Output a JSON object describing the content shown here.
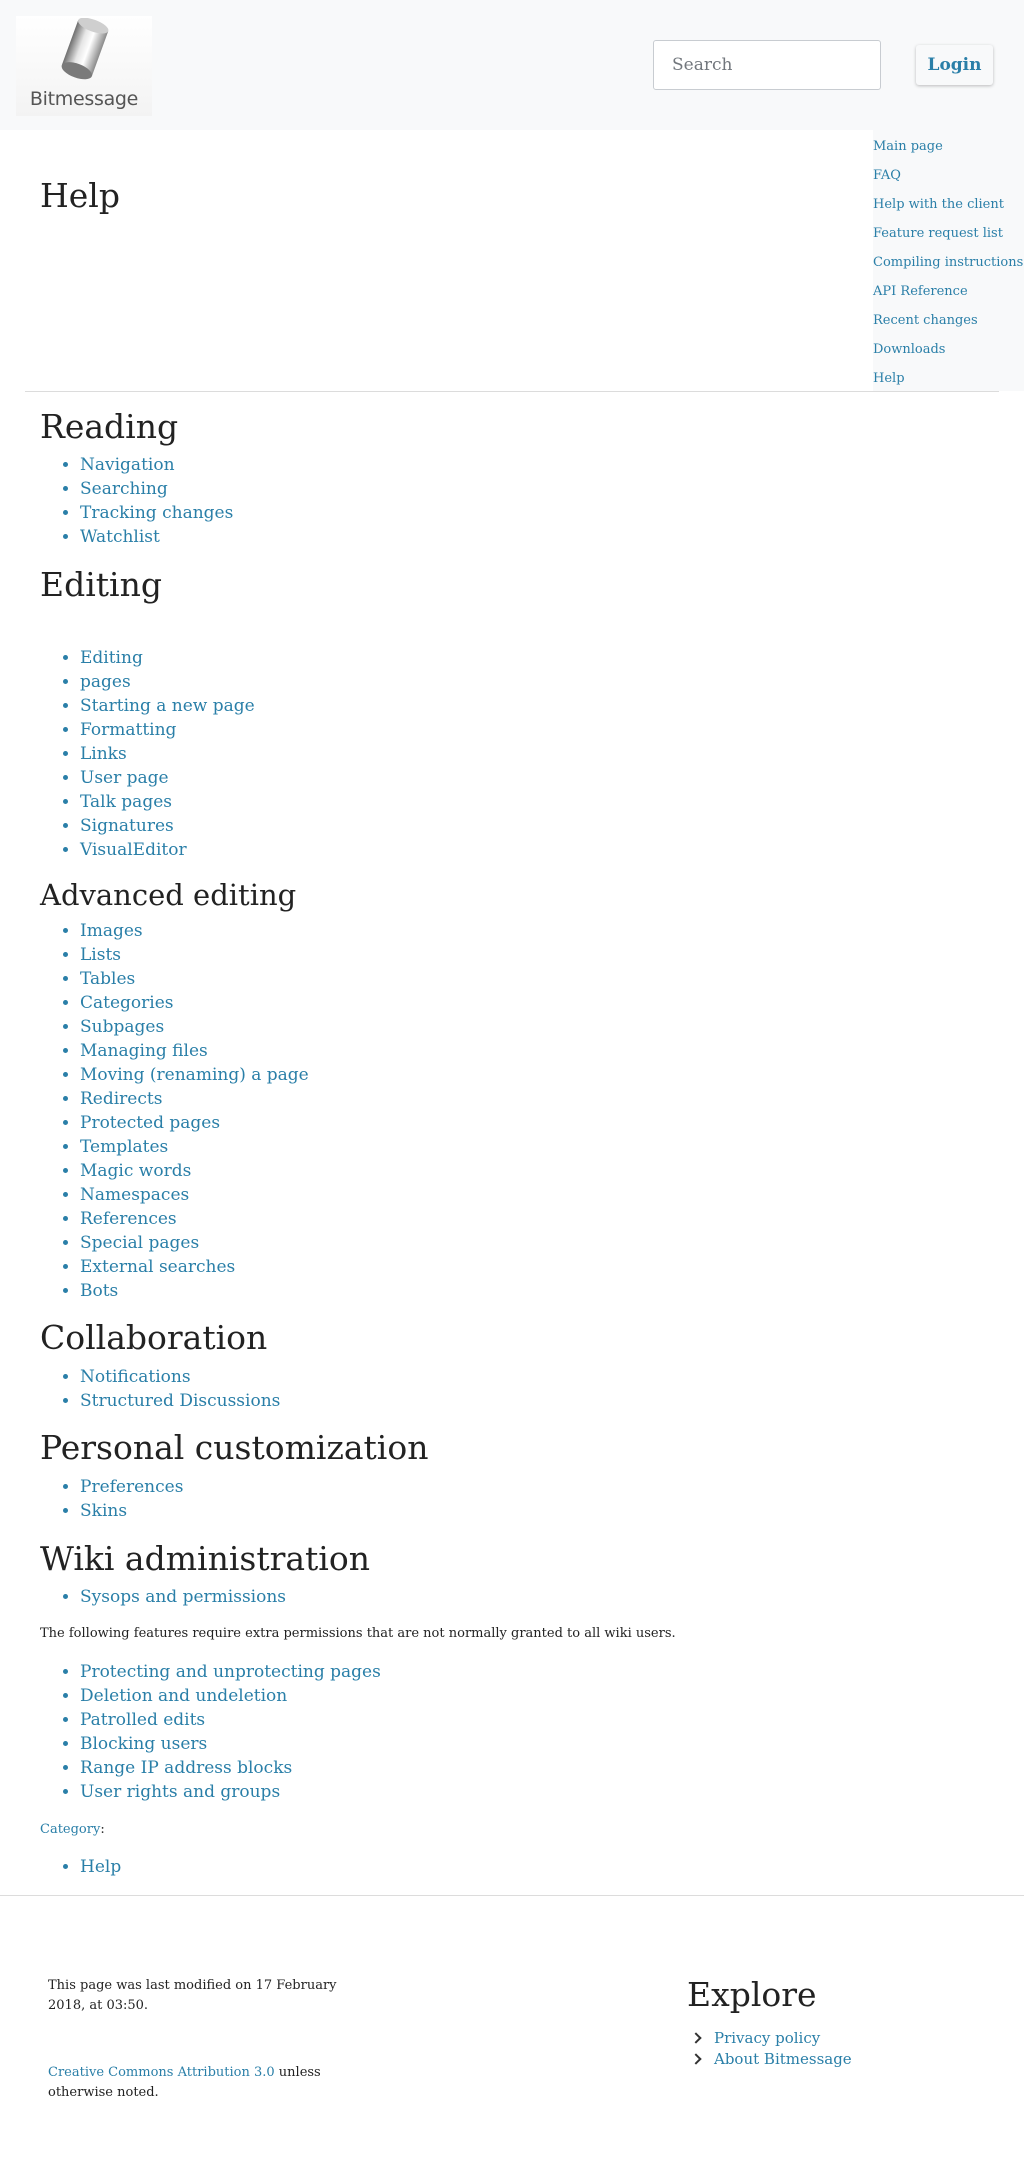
{
  "header": {
    "logo_text": "Bitmessage",
    "search_placeholder": "Search",
    "login_label": "Login"
  },
  "sidebar": {
    "items": [
      "Main page",
      "FAQ",
      "Help with the client",
      "Feature request list",
      "Compiling instructions",
      "API Reference",
      "Recent changes",
      "Downloads",
      "Help"
    ]
  },
  "page": {
    "title": "Help"
  },
  "sections": {
    "reading": {
      "title": "Reading",
      "items": [
        "Navigation",
        "Searching",
        "Tracking changes",
        "Watchlist"
      ]
    },
    "editing": {
      "title": "Editing",
      "items": [
        "Editing",
        "pages",
        "Starting a new page",
        "Formatting",
        "Links",
        "User page",
        "Talk pages",
        "Signatures",
        "VisualEditor"
      ]
    },
    "advanced": {
      "title": "Advanced editing",
      "items": [
        "Images",
        "Lists",
        "Tables",
        "Categories",
        "Subpages",
        "Managing files",
        "Moving (renaming) a page",
        "Redirects",
        "Protected pages",
        "Templates",
        "Magic words",
        "Namespaces",
        "References",
        "Special pages",
        "External searches",
        "Bots"
      ]
    },
    "collaboration": {
      "title": "Collaboration",
      "items": [
        "Notifications",
        "Structured Discussions"
      ]
    },
    "personal": {
      "title": "Personal customization",
      "items": [
        "Preferences",
        "Skins"
      ]
    },
    "wiki_admin": {
      "title": "Wiki administration",
      "items": [
        "Sysops and permissions"
      ],
      "note": "The following features require extra permissions that are not normally granted to all wiki users.",
      "extra_items": [
        "Protecting and unprotecting pages",
        "Deletion and undeletion",
        "Patrolled edits",
        "Blocking users",
        "Range IP address blocks",
        "User rights and groups"
      ]
    }
  },
  "category": {
    "label": "Category",
    "colon": ":",
    "items": [
      "Help"
    ]
  },
  "footer": {
    "last_modified": "This page was last modified on 17 February 2018, at 03:50.",
    "license_link": "Creative Commons Attribution 3.0",
    "license_suffix": " unless otherwise noted.",
    "explore_title": "Explore",
    "explore_items": [
      "Privacy policy",
      "About Bitmessage"
    ]
  }
}
